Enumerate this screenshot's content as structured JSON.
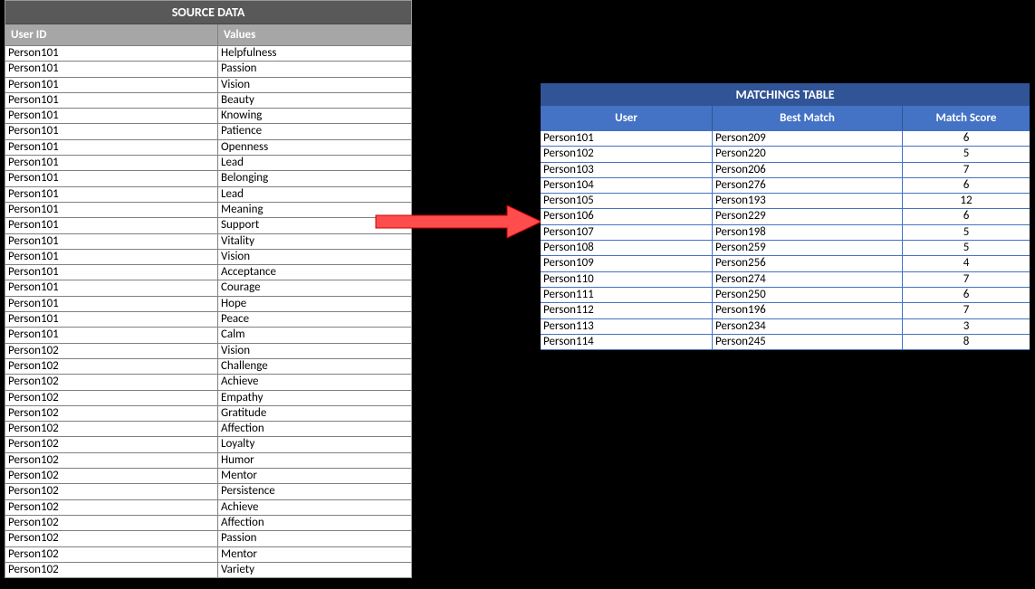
{
  "source": {
    "title": "SOURCE DATA",
    "headers": {
      "user": "User ID",
      "values": "Values"
    },
    "rows": [
      {
        "user": "Person101",
        "value": "Helpfulness"
      },
      {
        "user": "Person101",
        "value": "Passion"
      },
      {
        "user": "Person101",
        "value": "Vision"
      },
      {
        "user": "Person101",
        "value": "Beauty"
      },
      {
        "user": "Person101",
        "value": "Knowing"
      },
      {
        "user": "Person101",
        "value": "Patience"
      },
      {
        "user": "Person101",
        "value": "Openness"
      },
      {
        "user": "Person101",
        "value": "Lead"
      },
      {
        "user": "Person101",
        "value": "Belonging"
      },
      {
        "user": "Person101",
        "value": "Lead"
      },
      {
        "user": "Person101",
        "value": "Meaning"
      },
      {
        "user": "Person101",
        "value": "Support"
      },
      {
        "user": "Person101",
        "value": "Vitality"
      },
      {
        "user": "Person101",
        "value": "Vision"
      },
      {
        "user": "Person101",
        "value": "Acceptance"
      },
      {
        "user": "Person101",
        "value": "Courage"
      },
      {
        "user": "Person101",
        "value": "Hope"
      },
      {
        "user": "Person101",
        "value": "Peace"
      },
      {
        "user": "Person101",
        "value": "Calm"
      },
      {
        "user": "Person102",
        "value": "Vision"
      },
      {
        "user": "Person102",
        "value": "Challenge"
      },
      {
        "user": "Person102",
        "value": "Achieve"
      },
      {
        "user": "Person102",
        "value": "Empathy"
      },
      {
        "user": "Person102",
        "value": "Gratitude"
      },
      {
        "user": "Person102",
        "value": "Affection"
      },
      {
        "user": "Person102",
        "value": "Loyalty"
      },
      {
        "user": "Person102",
        "value": "Humor"
      },
      {
        "user": "Person102",
        "value": "Mentor"
      },
      {
        "user": "Person102",
        "value": "Persistence"
      },
      {
        "user": "Person102",
        "value": "Achieve"
      },
      {
        "user": "Person102",
        "value": "Affection"
      },
      {
        "user": "Person102",
        "value": "Passion"
      },
      {
        "user": "Person102",
        "value": "Mentor"
      },
      {
        "user": "Person102",
        "value": "Variety"
      }
    ]
  },
  "matchings": {
    "title": "MATCHINGS TABLE",
    "headers": {
      "user": "User",
      "match": "Best Match",
      "score": "Match Score"
    },
    "rows": [
      {
        "user": "Person101",
        "match": "Person209",
        "score": 6
      },
      {
        "user": "Person102",
        "match": "Person220",
        "score": 5
      },
      {
        "user": "Person103",
        "match": "Person206",
        "score": 7
      },
      {
        "user": "Person104",
        "match": "Person276",
        "score": 6
      },
      {
        "user": "Person105",
        "match": "Person193",
        "score": 12
      },
      {
        "user": "Person106",
        "match": "Person229",
        "score": 6
      },
      {
        "user": "Person107",
        "match": "Person198",
        "score": 5
      },
      {
        "user": "Person108",
        "match": "Person259",
        "score": 5
      },
      {
        "user": "Person109",
        "match": "Person256",
        "score": 4
      },
      {
        "user": "Person110",
        "match": "Person274",
        "score": 7
      },
      {
        "user": "Person111",
        "match": "Person250",
        "score": 6
      },
      {
        "user": "Person112",
        "match": "Person196",
        "score": 7
      },
      {
        "user": "Person113",
        "match": "Person234",
        "score": 3
      },
      {
        "user": "Person114",
        "match": "Person245",
        "score": 8
      }
    ]
  }
}
